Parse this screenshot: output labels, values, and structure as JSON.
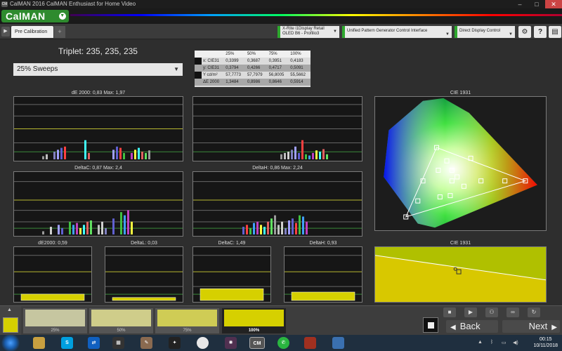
{
  "window": {
    "title": "CalMAN 2016 CalMAN Enthusiast for Home Video",
    "icon_label": "CM"
  },
  "header": {
    "logo": "CalMAN"
  },
  "tabs": {
    "active_label": "Pre Calibration",
    "add_label": "+"
  },
  "devices": {
    "meter_line1": "X-Rite i1Display Retail",
    "meter_line2": "OLED B6 - Profilio3",
    "generator": "Unified Pattern Generator Control Interface",
    "display": "Direct Display Control"
  },
  "toolbar": {
    "settings_label": "⚙",
    "help_label": "?",
    "layout_label": "▤"
  },
  "triplet": "Triplet: 235, 235, 235",
  "sweep_select": "25% Sweeps",
  "table": {
    "headers": [
      "25%",
      "50%",
      "75%",
      "100%"
    ],
    "rows": [
      {
        "label": "x: CIE31",
        "values": [
          "0,3399",
          "0,3687",
          "0,3951",
          "0,4183"
        ]
      },
      {
        "label": "y: CIE31",
        "values": [
          "0,3794",
          "0,4266",
          "0,4717",
          "0,5091"
        ]
      },
      {
        "label": "Y cd/m²",
        "values": [
          "57,7773",
          "57,7979",
          "56,8005",
          "55,5662"
        ]
      },
      {
        "label": "ΔE 2000",
        "values": [
          "1,3484",
          "0,8986",
          "0,8646",
          "0,5914"
        ]
      }
    ]
  },
  "panels": {
    "de2000": "dE 2000: 0,83  Max: 1,97",
    "deltac": "DeltaC: 0,87  Max: 2,4",
    "deltah": "DeltaH: 0,86  Max: 2,24",
    "cie_top": "CIE 1931",
    "cie_bottom": "CIE 1931",
    "small_de2000": "dE2000: 0,59",
    "small_deltal": "DeltaL: 0,03",
    "small_deltac": "DeltaC: 1,49",
    "small_deltah": "DeltaH: 0,93"
  },
  "small_bar_values": {
    "de2000": 0.59,
    "deltal": 0.03,
    "deltac": 1.49,
    "deltah": 0.93
  },
  "patches": [
    {
      "label": "25%",
      "color": "#c6c6a0"
    },
    {
      "label": "50%",
      "color": "#cfcd8a"
    },
    {
      "label": "75%",
      "color": "#cfcc55"
    },
    {
      "label": "100%",
      "color": "#d6d000"
    }
  ],
  "current_swatch_color": "#d6d000",
  "nav": {
    "back": "Back",
    "next": "Next"
  },
  "clock": {
    "time": "00:15",
    "date": "10/11/2018"
  },
  "taskbar": {
    "cm_label": "CM"
  }
}
